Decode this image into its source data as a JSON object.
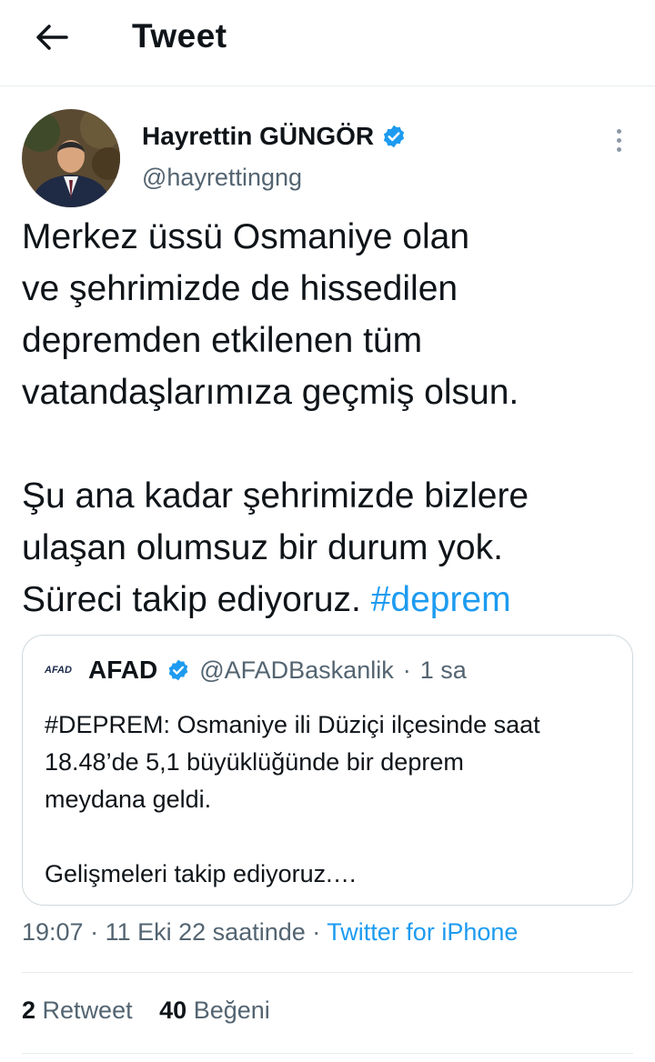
{
  "header": {
    "title": "Tweet",
    "back_icon": "arrow-left-icon"
  },
  "author": {
    "name": "Hayrettin GÜNGÖR",
    "handle": "@hayrettingng",
    "verified_icon": "verified-badge-icon",
    "more_icon": "more-vertical-icon"
  },
  "tweet": {
    "paragraph1": [
      "Merkez üssü Osmaniye olan",
      "ve şehrimizde de hissedilen",
      "depremden etkilenen tüm",
      "vatandaşlarımıza geçmiş olsun."
    ],
    "paragraph2": [
      "Şu ana kadar şehrimizde bizlere",
      "ulaşan olumsuz bir durum yok."
    ],
    "last_line_text": "Süreci takip ediyoruz. ",
    "hashtag": "#deprem"
  },
  "quote": {
    "logo_text": "AFAD",
    "name": "AFAD",
    "handle": "@AFADBaskanlik",
    "separator": "·",
    "time": "1 sa",
    "lines": [
      "#DEPREM: Osmaniye ili Düziçi ilçesinde saat",
      "18.48’de 5,1 büyüklüğünde bir deprem",
      "meydana geldi."
    ],
    "continuation": "Gelişmeleri takip ediyoruz.…"
  },
  "meta": {
    "time": "19:07",
    "date": "11 Eki 22 saatinde",
    "separator": "·",
    "source": "Twitter for iPhone"
  },
  "stats": {
    "retweets_count": "2",
    "retweets_label": "Retweet",
    "likes_count": "40",
    "likes_label": "Beğeni"
  },
  "colors": {
    "accent": "#1d9bf0",
    "verified": "#1d9bf0",
    "text": "#0f1419",
    "secondary": "#536471"
  }
}
